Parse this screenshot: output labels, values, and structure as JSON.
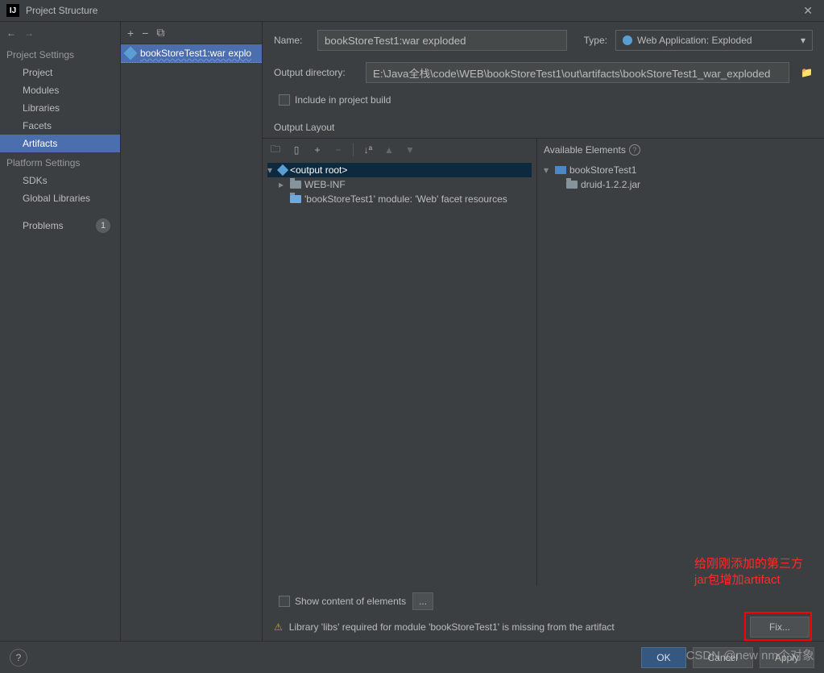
{
  "window": {
    "title": "Project Structure"
  },
  "nav": {
    "projectSettings": "Project Settings",
    "items1": [
      "Project",
      "Modules",
      "Libraries",
      "Facets",
      "Artifacts"
    ],
    "platformSettings": "Platform Settings",
    "items2": [
      "SDKs",
      "Global Libraries"
    ],
    "problems": "Problems",
    "problemsCount": "1"
  },
  "artifactList": {
    "item0": "bookStoreTest1:war explo"
  },
  "form": {
    "nameLabel": "Name:",
    "nameValue": "bookStoreTest1:war exploded",
    "typeLabel": "Type:",
    "typeValue": "Web Application: Exploded",
    "outputDirLabel": "Output directory:",
    "outputDirValue": "E:\\Java全栈\\code\\WEB\\bookStoreTest1\\out\\artifacts\\bookStoreTest1_war_exploded",
    "includeLabel": "Include in project build",
    "outputLayoutTab": "Output Layout"
  },
  "tree": {
    "root": "<output root>",
    "webinf": "WEB-INF",
    "facet": "'bookStoreTest1' module: 'Web' facet resources"
  },
  "available": {
    "header": "Available Elements",
    "project": "bookStoreTest1",
    "jar": "druid-1.2.2.jar"
  },
  "bottom": {
    "showContent": "Show content of elements",
    "dots": "..."
  },
  "warning": {
    "text": "Library 'libs' required for module 'bookStoreTest1' is missing from the artifact",
    "fix": "Fix..."
  },
  "annotation": {
    "line1": "给刚刚添加的第三方",
    "line2": "jar包增加artifact"
  },
  "footer": {
    "ok": "OK",
    "cancel": "Cancel",
    "apply": "Apply"
  },
  "watermark": "CSDN @new nm个对象"
}
